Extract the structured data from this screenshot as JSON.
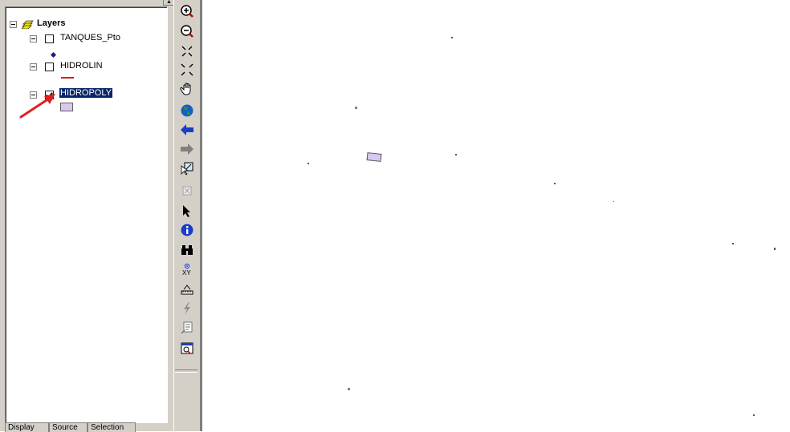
{
  "toc": {
    "root_label": "Layers",
    "layers": [
      {
        "name": "TANQUES_Pto",
        "checked": false,
        "selected": false,
        "symbol": "point-diamond",
        "symbol_color": "#1a1a80"
      },
      {
        "name": "HIDROLIN",
        "checked": false,
        "selected": false,
        "symbol": "line",
        "symbol_color": "#cc2222"
      },
      {
        "name": "HIDROPOLY",
        "checked": true,
        "selected": true,
        "symbol": "polygon",
        "symbol_color": "#d8c8f0"
      }
    ],
    "tabs": [
      "Display",
      "Source",
      "Selection"
    ]
  },
  "tools": [
    {
      "name": "zoom-in-icon"
    },
    {
      "name": "zoom-out-icon"
    },
    {
      "name": "fixed-zoom-in-icon"
    },
    {
      "name": "fixed-zoom-out-icon"
    },
    {
      "name": "pan-hand-icon"
    },
    {
      "name": "full-extent-globe-icon"
    },
    {
      "name": "back-arrow-icon"
    },
    {
      "name": "forward-arrow-icon"
    },
    {
      "name": "select-features-icon"
    },
    {
      "name": "clear-selection-icon"
    },
    {
      "name": "select-elements-pointer-icon"
    },
    {
      "name": "identify-icon"
    },
    {
      "name": "find-binoculars-icon"
    },
    {
      "name": "go-to-xy-icon"
    },
    {
      "name": "measure-icon"
    },
    {
      "name": "hyperlink-lightning-icon"
    },
    {
      "name": "html-popup-icon"
    },
    {
      "name": "create-viewer-window-icon"
    }
  ],
  "annotation": {
    "arrow_color": "#e02020"
  }
}
